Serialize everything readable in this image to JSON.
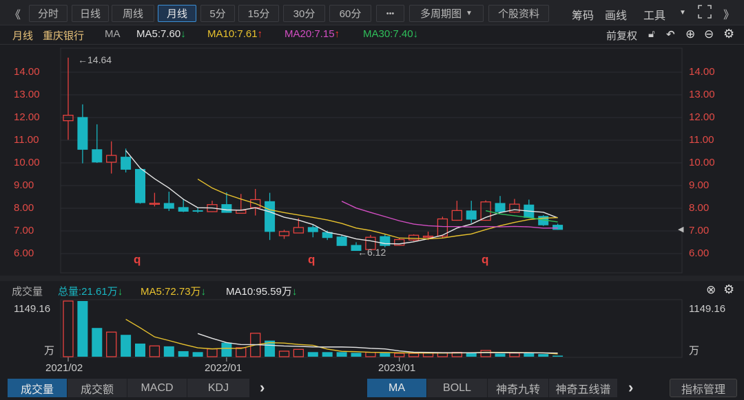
{
  "toolbar": {
    "collapse_left": "《",
    "periods": [
      {
        "label": "分时"
      },
      {
        "label": "日线"
      },
      {
        "label": "周线"
      },
      {
        "label": "月线",
        "active": true
      },
      {
        "label": "5分"
      },
      {
        "label": "15分"
      },
      {
        "label": "30分"
      },
      {
        "label": "60分"
      },
      {
        "label": "•••"
      }
    ],
    "multi_period": "多周期图",
    "stock_info": "个股资料",
    "chips": "筹码",
    "draw": "画线",
    "tools": "工具",
    "collapse_right": "》"
  },
  "legend": {
    "period": "月线",
    "stock": "重庆银行",
    "indicator": "MA",
    "ma5": "MA5:7.60",
    "ma10": "MA10:7.61",
    "ma20": "MA20:7.15",
    "ma30": "MA30:7.40",
    "adjust": "前复权"
  },
  "colors": {
    "up": "#e8423f",
    "down": "#19b5c1",
    "ma5": "#e6e6e6",
    "ma10": "#e8c22e",
    "ma20": "#d24ec2",
    "ma30": "#2fbf5a",
    "arrow_up": "#ff3b30",
    "arrow_down": "#22c55e"
  },
  "price_axis": {
    "ticks": [
      "14.00",
      "13.00",
      "12.00",
      "11.00",
      "10.00",
      "9.00",
      "8.00",
      "7.00",
      "6.00"
    ],
    "high_label": "←14.64",
    "low_label": "←6.12",
    "markers": [
      "q",
      "q",
      "q"
    ]
  },
  "volume": {
    "title": "成交量",
    "total": "总量:21.61万",
    "ma5": "MA5:72.73万",
    "ma10": "MA10:95.59万",
    "max_label": "1149.16",
    "unit_label": "万"
  },
  "dates": [
    "2021/02",
    "2022/01",
    "2023/01"
  ],
  "chart_data": {
    "type": "candlestick",
    "title": "重庆银行 月线",
    "ylim": [
      5.7,
      14.9
    ],
    "volume_max": 1149.16,
    "ohlc": [
      [
        11.86,
        14.64,
        11.02,
        12.1
      ],
      [
        12.02,
        12.58,
        9.98,
        10.58
      ],
      [
        10.6,
        11.7,
        10.0,
        10.02
      ],
      [
        10.03,
        10.95,
        9.53,
        10.33
      ],
      [
        10.27,
        10.63,
        9.58,
        9.7
      ],
      [
        9.73,
        9.75,
        8.2,
        8.23
      ],
      [
        8.18,
        8.68,
        8.08,
        8.22
      ],
      [
        8.23,
        8.73,
        7.88,
        7.98
      ],
      [
        8.05,
        8.4,
        7.83,
        7.85
      ],
      [
        7.91,
        8.0,
        7.8,
        7.85
      ],
      [
        7.85,
        8.33,
        7.83,
        8.16
      ],
      [
        8.18,
        8.7,
        7.8,
        7.8
      ],
      [
        7.78,
        8.63,
        7.78,
        7.91
      ],
      [
        8.03,
        8.85,
        7.68,
        8.38
      ],
      [
        8.31,
        8.68,
        6.6,
        6.96
      ],
      [
        6.79,
        7.05,
        6.65,
        6.97
      ],
      [
        6.91,
        7.56,
        6.9,
        7.15
      ],
      [
        7.17,
        7.27,
        6.72,
        6.95
      ],
      [
        6.95,
        7.02,
        6.6,
        6.69
      ],
      [
        6.75,
        6.82,
        6.34,
        6.34
      ],
      [
        6.38,
        6.5,
        6.12,
        6.12
      ],
      [
        6.18,
        6.82,
        6.15,
        6.72
      ],
      [
        6.77,
        6.87,
        6.28,
        6.34
      ],
      [
        6.37,
        6.69,
        6.35,
        6.62
      ],
      [
        6.6,
        6.85,
        6.55,
        6.81
      ],
      [
        6.72,
        6.97,
        6.6,
        6.77
      ],
      [
        6.77,
        7.63,
        6.7,
        7.53
      ],
      [
        7.47,
        8.33,
        7.45,
        7.9
      ],
      [
        7.9,
        8.33,
        7.35,
        7.5
      ],
      [
        7.47,
        8.35,
        7.45,
        8.28
      ],
      [
        8.23,
        8.54,
        7.8,
        7.83
      ],
      [
        7.83,
        8.41,
        7.8,
        8.18
      ],
      [
        8.16,
        8.38,
        7.58,
        7.58
      ],
      [
        7.66,
        7.7,
        7.22,
        7.25
      ],
      [
        7.27,
        7.32,
        7.05,
        7.05
      ]
    ],
    "volumes": [
      1149,
      1160,
      593,
      508,
      451,
      271,
      223,
      214,
      114,
      95,
      161,
      290,
      185,
      484,
      332,
      114,
      152,
      95,
      95,
      95,
      80,
      90,
      75,
      70,
      70,
      75,
      85,
      90,
      80,
      130,
      65,
      75,
      70,
      55,
      22
    ],
    "ma_periods": [
      5,
      10,
      20,
      30
    ],
    "volume_ma_periods": [
      5,
      10
    ]
  },
  "bottom_tabs": {
    "left": [
      {
        "label": "成交量",
        "active": true
      },
      {
        "label": "成交额"
      },
      {
        "label": "MACD"
      },
      {
        "label": "KDJ"
      }
    ],
    "right": [
      {
        "label": "MA",
        "active": true
      },
      {
        "label": "BOLL"
      },
      {
        "label": "神奇九转"
      },
      {
        "label": "神奇五线谱"
      }
    ],
    "more": "›",
    "manage": "指标管理"
  }
}
